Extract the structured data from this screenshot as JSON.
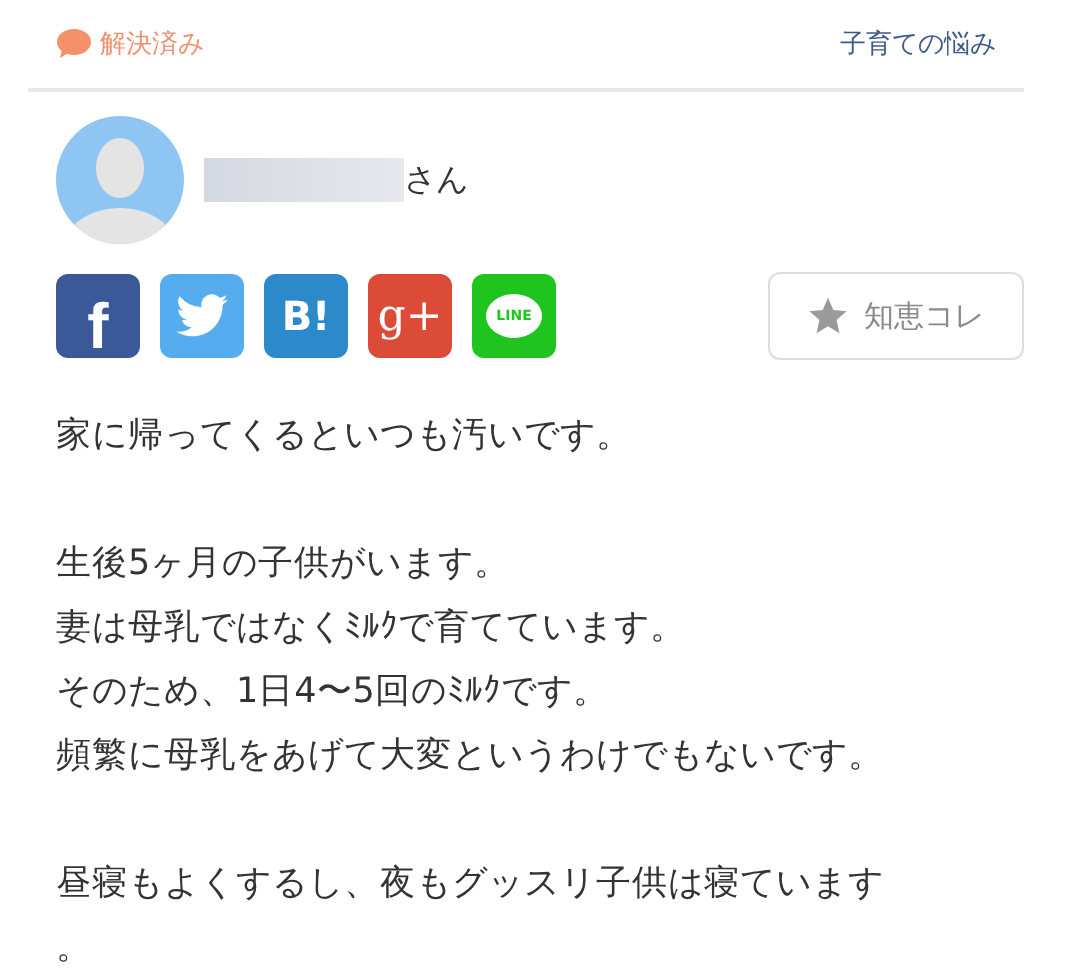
{
  "header": {
    "status": "解決済み",
    "category": "子育ての悩み"
  },
  "user": {
    "suffix": "さん"
  },
  "share_buttons": [
    {
      "kind": "facebook",
      "glyph": "f"
    },
    {
      "kind": "twitter"
    },
    {
      "kind": "hatena",
      "glyph": "B!"
    },
    {
      "kind": "googleplus",
      "glyph": "g+"
    },
    {
      "kind": "line",
      "glyph": "LINE"
    }
  ],
  "save_button": {
    "label": "知恵コレ"
  },
  "body": [
    [
      "家に帰ってくるといつも汚いです。"
    ],
    [
      "生後5ヶ月の子供がいます。",
      "妻は母乳ではなくﾐﾙｸで育てています。",
      "そのため、1日4〜5回のﾐﾙｸです。",
      "頻繁に母乳をあげて大変というわけでもないです。"
    ],
    [
      "昼寝もよくするし、夜もグッスリ子供は寝ています",
      "。"
    ]
  ]
}
